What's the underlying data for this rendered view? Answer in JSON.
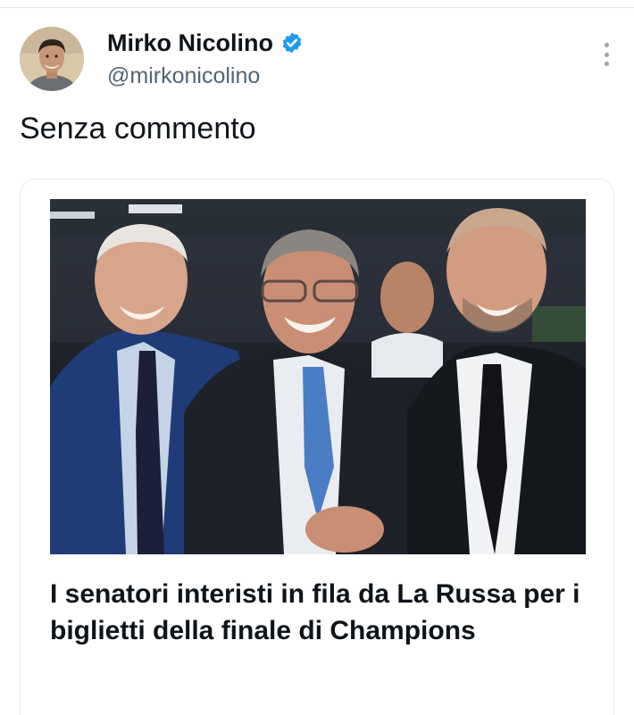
{
  "tweet": {
    "author": {
      "display_name": "Mirko Nicolino",
      "handle": "@mirkonicolino",
      "verified": true
    },
    "text": "Senza commento"
  },
  "card": {
    "headline": "I senatori interisti in fila da La Russa per i biglietti della finale di Champions"
  },
  "colors": {
    "verified_badge": "#1d9bf0",
    "handle_gray": "#536471"
  }
}
